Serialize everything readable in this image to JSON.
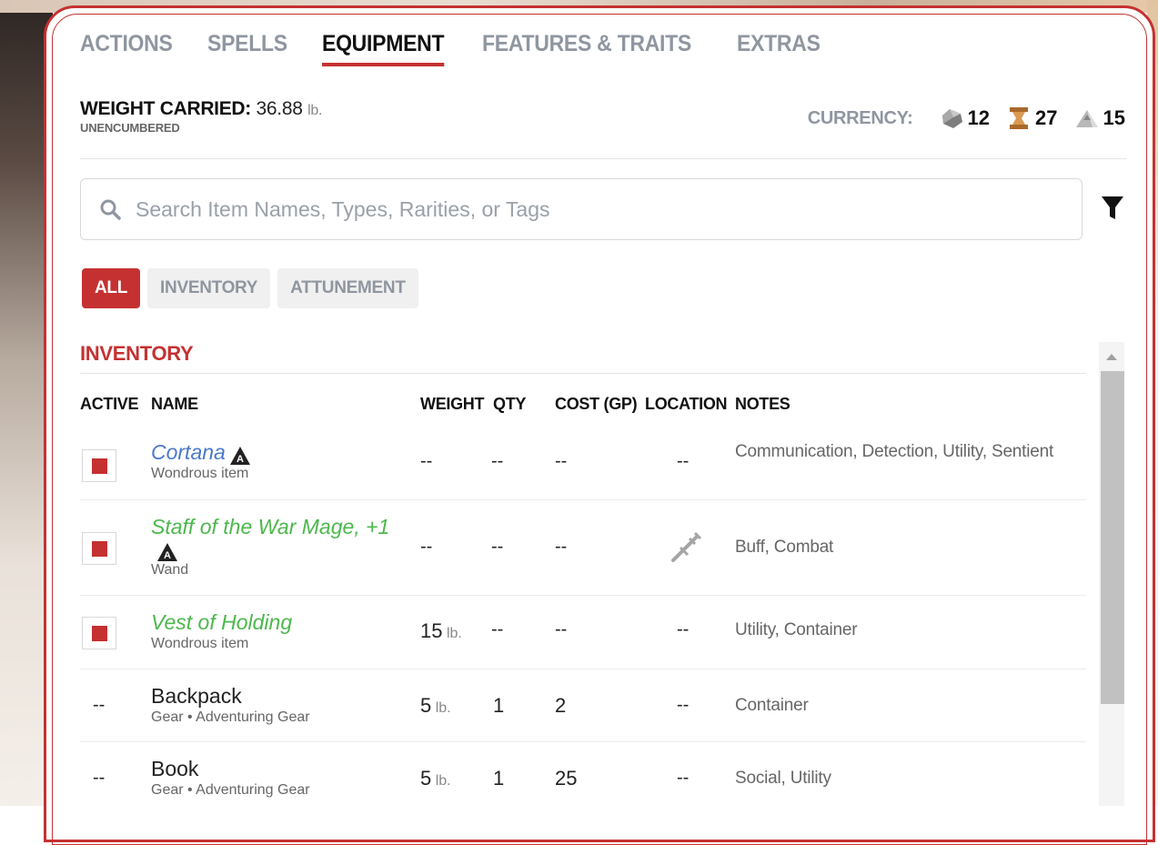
{
  "tabs": [
    {
      "label": "ACTIONS",
      "active": false
    },
    {
      "label": "SPELLS",
      "active": false
    },
    {
      "label": "EQUIPMENT",
      "active": true
    },
    {
      "label": "FEATURES & TRAITS",
      "active": false
    },
    {
      "label": "EXTRAS",
      "active": false
    }
  ],
  "weight": {
    "label": "WEIGHT CARRIED:",
    "value": "36.88",
    "unit": "lb.",
    "status": "UNENCUMBERED"
  },
  "currency": {
    "label": "CURRENCY:",
    "coins": [
      {
        "icon": "platinum-coin-icon",
        "amount": "12",
        "color": "#8b8b8b"
      },
      {
        "icon": "gold-coin-icon",
        "amount": "27",
        "color": "#c68a3e"
      },
      {
        "icon": "silver-coin-icon",
        "amount": "15",
        "color": "#b0b0b0"
      }
    ]
  },
  "search": {
    "placeholder": "Search Item Names, Types, Rarities, or Tags"
  },
  "filters": [
    {
      "label": "ALL",
      "active": true
    },
    {
      "label": "INVENTORY",
      "active": false
    },
    {
      "label": "ATTUNEMENT",
      "active": false
    }
  ],
  "inventory": {
    "title": "INVENTORY",
    "columns": [
      "ACTIVE",
      "NAME",
      "WEIGHT",
      "QTY",
      "COST (GP)",
      "LOCATION",
      "NOTES"
    ],
    "rows": [
      {
        "active": true,
        "name": "Cortana",
        "rarity_color": "blue",
        "attunement": true,
        "type": "Wondrous item",
        "weight": "--",
        "weight_unit": "",
        "qty": "--",
        "cost": "--",
        "location": "--",
        "notes": "Communication, Detection, Utility, Sentient"
      },
      {
        "active": true,
        "name": "Staff of the War Mage, +1",
        "rarity_color": "green",
        "attunement": true,
        "type": "Wand",
        "weight": "--",
        "weight_unit": "",
        "qty": "--",
        "cost": "--",
        "location": "equipped-weapon-icon",
        "notes": "Buff, Combat"
      },
      {
        "active": true,
        "name": "Vest of Holding",
        "rarity_color": "green",
        "attunement": false,
        "type": "Wondrous item",
        "weight": "15",
        "weight_unit": "lb.",
        "qty": "--",
        "cost": "--",
        "location": "--",
        "notes": "Utility, Container"
      },
      {
        "active": false,
        "active_text": "--",
        "name": "Backpack",
        "rarity_color": "plain",
        "attunement": false,
        "type": "Gear • Adventuring Gear",
        "weight": "5",
        "weight_unit": "lb.",
        "qty": "1",
        "cost": "2",
        "location": "--",
        "notes": "Container"
      },
      {
        "active": false,
        "active_text": "--",
        "name": "Book",
        "rarity_color": "plain",
        "attunement": false,
        "type": "Gear • Adventuring Gear",
        "weight": "5",
        "weight_unit": "lb.",
        "qty": "1",
        "cost": "25",
        "location": "--",
        "notes": "Social, Utility"
      }
    ]
  },
  "colors": {
    "accent": "#c53131",
    "uncommon": "#4cb84c",
    "rare": "#4a79c9"
  }
}
